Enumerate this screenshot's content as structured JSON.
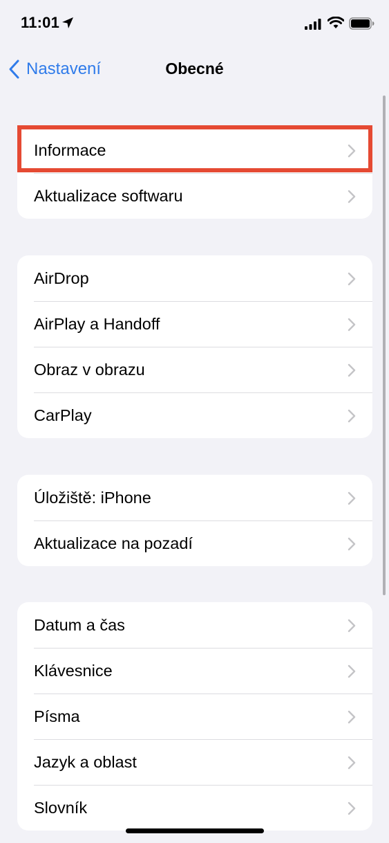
{
  "status_bar": {
    "time": "11:01",
    "icons": [
      "location-icon",
      "signal-icon",
      "wifi-icon",
      "battery-icon"
    ]
  },
  "nav": {
    "back_label": "Nastavení",
    "title": "Obecné"
  },
  "groups": [
    {
      "items": [
        {
          "label": "Informace",
          "highlighted": true
        },
        {
          "label": "Aktualizace softwaru"
        }
      ]
    },
    {
      "items": [
        {
          "label": "AirDrop"
        },
        {
          "label": "AirPlay a Handoff"
        },
        {
          "label": "Obraz v obrazu"
        },
        {
          "label": "CarPlay"
        }
      ]
    },
    {
      "items": [
        {
          "label": "Úložiště: iPhone"
        },
        {
          "label": "Aktualizace na pozadí"
        }
      ]
    },
    {
      "items": [
        {
          "label": "Datum a čas"
        },
        {
          "label": "Klávesnice"
        },
        {
          "label": "Písma"
        },
        {
          "label": "Jazyk a oblast"
        },
        {
          "label": "Slovník"
        }
      ]
    }
  ],
  "colors": {
    "accent": "#2f7bea",
    "highlight": "#e54a33",
    "background": "#f2f2f7"
  }
}
